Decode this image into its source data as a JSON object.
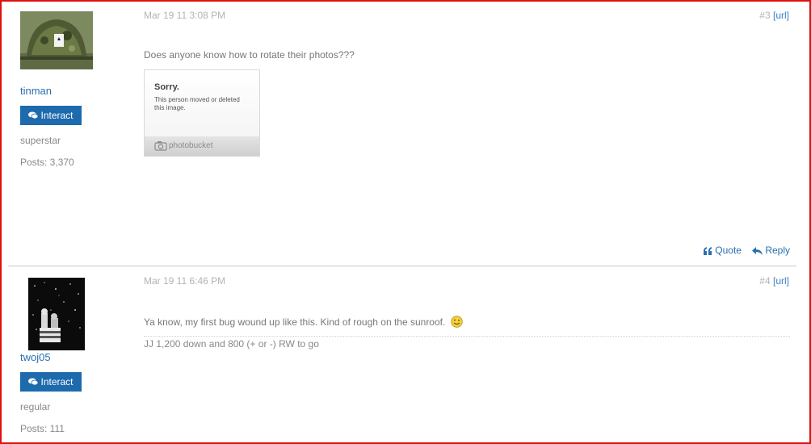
{
  "posts": [
    {
      "username": "tinman",
      "interact_label": "Interact",
      "rank": "superstar",
      "posts_count": "Posts: 3,370",
      "date": "Mar 19 11 3:08 PM",
      "post_number": "#3",
      "url_label": "[url]",
      "message": "Does anyone know how to rotate their photos???",
      "image_placeholder": {
        "title": "Sorry.",
        "text": "This person moved or deleted this image.",
        "brand": "photobucket"
      },
      "actions": {
        "quote_label": "Quote",
        "reply_label": "Reply"
      }
    },
    {
      "username": "twoj05",
      "interact_label": "Interact",
      "rank": "regular",
      "posts_count": "Posts: 111",
      "date": "Mar 19 11 6:46 PM",
      "post_number": "#4",
      "url_label": "[url]",
      "message": "Ya know, my first bug wound up like this. Kind of rough on the sunroof.",
      "signature": "JJ 1,200 down and 800 (+ or -) RW to go"
    }
  ],
  "icons": {
    "interact": "comments-icon",
    "quote": "quote-icon",
    "reply": "reply-arrow-icon",
    "smiley": "wink-smiley-icon",
    "camera": "camera-icon"
  },
  "colors": {
    "link": "#2a6fb0",
    "button": "#1d6aad",
    "frame": "#e01010"
  }
}
